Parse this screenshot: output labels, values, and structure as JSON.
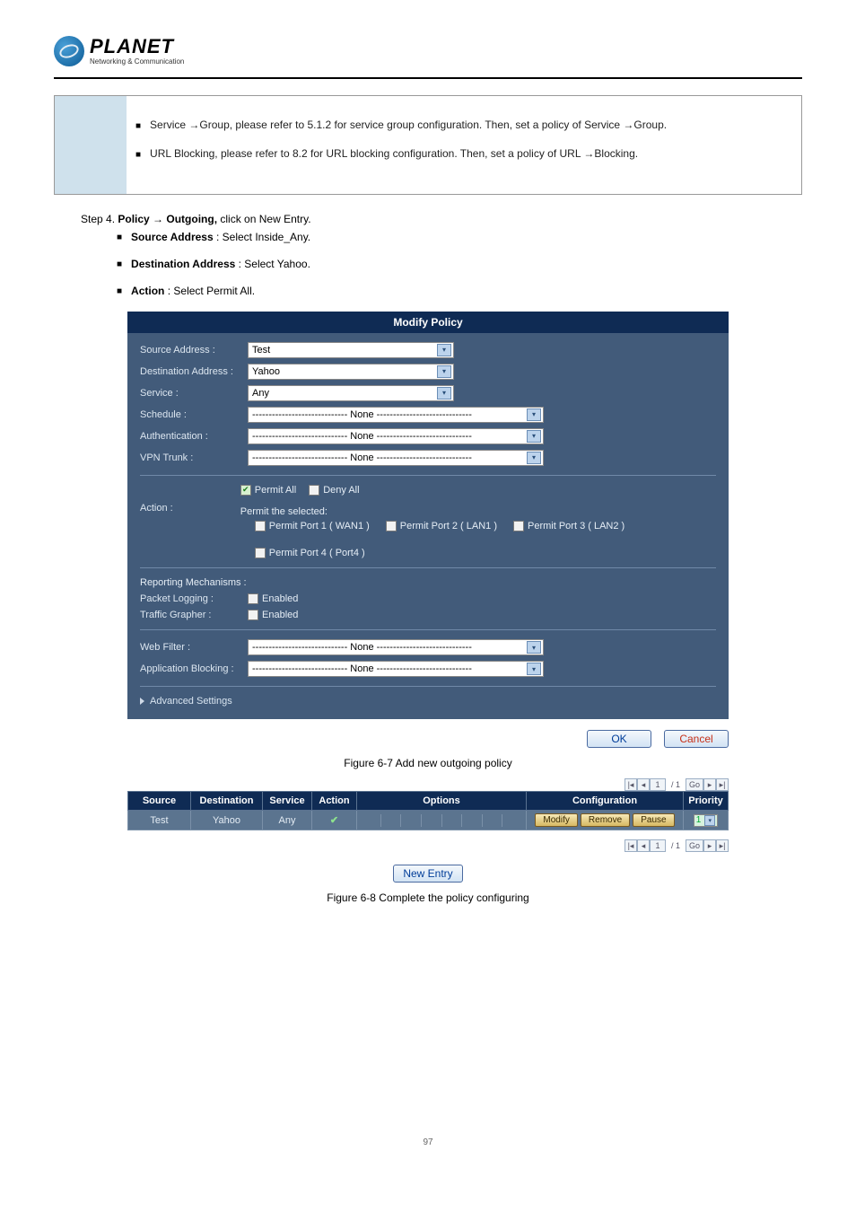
{
  "header": {
    "logo_title": "PLANET",
    "logo_sub": "Networking & Communication"
  },
  "notes": {
    "n1": "Service →Group, please refer to 5.1.2 for service group configuration. Then, set a policy of Service →Group.",
    "n2": "URL Blocking, please refer to 8.2 for URL blocking configuration. Then, set a policy of URL →Blocking."
  },
  "step": {
    "prefix": "Step 4. ",
    "bold": "Policy → Outgoing,",
    "suffix": " click on New Entry."
  },
  "bullets": {
    "b1": {
      "label": "Source Address ",
      "rest": ": Select Inside_Any."
    },
    "b2": {
      "label": "Destination Address ",
      "rest": ": Select Yahoo."
    },
    "b3": {
      "label": "Action ",
      "rest": ": Select Permit All."
    }
  },
  "panel": {
    "title": "Modify Policy",
    "fields": {
      "source": {
        "label": "Source Address :",
        "value": "Test"
      },
      "destination": {
        "label": "Destination Address :",
        "value": "Yahoo"
      },
      "service": {
        "label": "Service :",
        "value": "Any"
      },
      "schedule": {
        "label": "Schedule :",
        "value": "----------------------------- None -----------------------------"
      },
      "auth": {
        "label": "Authentication :",
        "value": "----------------------------- None -----------------------------"
      },
      "vpn": {
        "label": "VPN Trunk :",
        "value": "----------------------------- None -----------------------------"
      }
    },
    "action": {
      "label": "Action :",
      "permit_all": "Permit All",
      "deny_all": "Deny All",
      "permit_selected": "Permit the selected:",
      "ports": [
        "Permit Port  1  ( WAN1 )",
        "Permit Port  2  ( LAN1 )",
        "Permit Port  3  ( LAN2 )",
        "Permit Port  4  ( Port4 )"
      ]
    },
    "reporting": {
      "heading": "Reporting Mechanisms :",
      "packet": {
        "label": "Packet Logging :",
        "value": "Enabled"
      },
      "traffic": {
        "label": "Traffic Grapher :",
        "value": "Enabled"
      }
    },
    "filters": {
      "web": {
        "label": "Web Filter : ",
        "value": "----------------------------- None -----------------------------"
      },
      "app": {
        "label": "Application Blocking :",
        "value": "----------------------------- None -----------------------------"
      }
    },
    "advanced": "Advanced Settings"
  },
  "buttons": {
    "ok": "OK",
    "cancel": "Cancel",
    "new_entry": "New Entry"
  },
  "captions": {
    "c1": "Figure 6-7 Add new outgoing policy",
    "c2": "Figure 6-8 Complete the policy configuring"
  },
  "pager": {
    "page": "1",
    "slash": "/ 1",
    "go": "Go"
  },
  "table": {
    "headers": [
      "Source",
      "Destination",
      "Service",
      "Action",
      "Options",
      "Configuration",
      "Priority"
    ],
    "row": {
      "source": "Test",
      "destination": "Yahoo",
      "service": "Any",
      "cfg": [
        "Modify",
        "Remove",
        "Pause"
      ],
      "priority": "1"
    }
  },
  "footer": {
    "page": "97"
  }
}
